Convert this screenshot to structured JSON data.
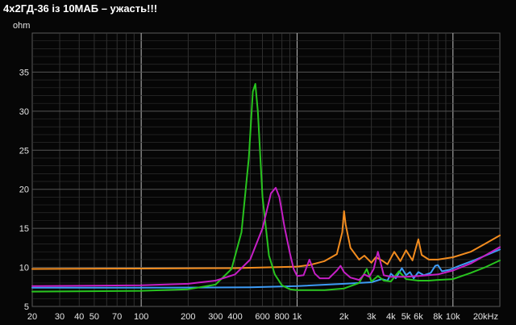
{
  "header": {
    "title": "4х2ГД-36 із 10МАБ – ужасть!!!"
  },
  "chart_data": {
    "type": "line",
    "title": "4х2ГД-36 із 10МАБ – ужасть!!!",
    "xlabel": "",
    "ylabel": "ohm",
    "xscale": "log",
    "xlim": [
      20,
      20000
    ],
    "ylim": [
      5,
      40
    ],
    "grid": true,
    "background": "#060606",
    "x_tick_values": [
      20,
      30,
      40,
      50,
      70,
      100,
      200,
      300,
      400,
      600,
      800,
      1000,
      2000,
      3000,
      4000,
      5000,
      6000,
      8000,
      10000,
      20000
    ],
    "x_tick_labels": [
      "20",
      "30",
      "40",
      "50",
      "70",
      "100",
      "200",
      "300",
      "400",
      "600",
      "800",
      "1k",
      "2k",
      "3k",
      "4k",
      "5k",
      "6k",
      "8k",
      "10k",
      "20kHz"
    ],
    "y_tick_values": [
      5,
      10,
      15,
      20,
      25,
      30,
      35
    ],
    "y_tick_labels": [
      "5",
      "10",
      "15",
      "20",
      "25",
      "30",
      "35"
    ],
    "series": [
      {
        "color": "#f28c1f",
        "x": [
          20,
          100,
          400,
          1000,
          1200,
          1500,
          1800,
          1950,
          2000,
          2050,
          2200,
          2500,
          2700,
          3000,
          3200,
          3500,
          3800,
          4200,
          4600,
          5000,
          5500,
          5800,
          6000,
          6300,
          7000,
          8000,
          10000,
          13000,
          16000,
          20000
        ],
        "y": [
          9.8,
          9.85,
          9.9,
          10.1,
          10.3,
          10.8,
          11.7,
          14.5,
          17.2,
          15.5,
          12.5,
          11.0,
          11.5,
          10.6,
          11.3,
          10.9,
          10.4,
          12.0,
          10.8,
          12.2,
          10.9,
          12.6,
          13.6,
          11.6,
          11.0,
          11.0,
          11.3,
          12.0,
          13.0,
          14.1
        ]
      },
      {
        "color": "#3d9bf5",
        "x": [
          20,
          100,
          500,
          1000,
          2000,
          3000,
          3500,
          3800,
          4000,
          4300,
          4700,
          5000,
          5300,
          5600,
          6000,
          6500,
          7200,
          7700,
          8000,
          8500,
          9500,
          11000,
          14000,
          20000
        ],
        "y": [
          7.4,
          7.4,
          7.45,
          7.6,
          7.9,
          8.1,
          8.5,
          8.3,
          9.2,
          8.6,
          9.9,
          9.0,
          9.4,
          8.6,
          9.4,
          9.0,
          9.3,
          10.2,
          10.3,
          9.5,
          9.7,
          10.2,
          11.0,
          12.3
        ]
      },
      {
        "color": "#28c41e",
        "x": [
          20,
          100,
          200,
          300,
          380,
          440,
          490,
          520,
          540,
          560,
          600,
          660,
          720,
          800,
          900,
          1000,
          1500,
          2000,
          2500,
          2800,
          3000,
          3300,
          3600,
          4000,
          4500,
          5000,
          6000,
          7000,
          8000,
          10000,
          13000,
          16000,
          20000
        ],
        "y": [
          6.9,
          7.0,
          7.2,
          7.8,
          9.8,
          14.5,
          24.0,
          32.5,
          33.5,
          30.0,
          19.0,
          11.5,
          9.1,
          7.7,
          7.2,
          7.1,
          7.1,
          7.3,
          8.0,
          9.8,
          8.2,
          8.9,
          8.3,
          8.2,
          9.5,
          8.5,
          8.3,
          8.3,
          8.4,
          8.5,
          9.3,
          10.0,
          10.9
        ]
      },
      {
        "color": "#c51fc5",
        "x": [
          20,
          100,
          200,
          300,
          400,
          500,
          600,
          680,
          730,
          770,
          830,
          900,
          950,
          1000,
          1100,
          1200,
          1300,
          1400,
          1600,
          1800,
          1900,
          2000,
          2200,
          2500,
          2700,
          2900,
          3100,
          3300,
          3600,
          4000,
          5000,
          6000,
          8000,
          10000,
          13000,
          16000,
          20000
        ],
        "y": [
          7.6,
          7.7,
          7.9,
          8.3,
          9.1,
          11.0,
          15.0,
          19.5,
          20.2,
          19.0,
          15.2,
          11.8,
          9.8,
          8.9,
          9.0,
          11.0,
          9.2,
          8.6,
          8.6,
          9.6,
          10.2,
          9.4,
          8.7,
          8.4,
          9.1,
          8.8,
          9.8,
          12.0,
          9.0,
          8.8,
          8.8,
          8.9,
          9.1,
          9.6,
          10.5,
          11.5,
          12.6
        ]
      }
    ]
  }
}
